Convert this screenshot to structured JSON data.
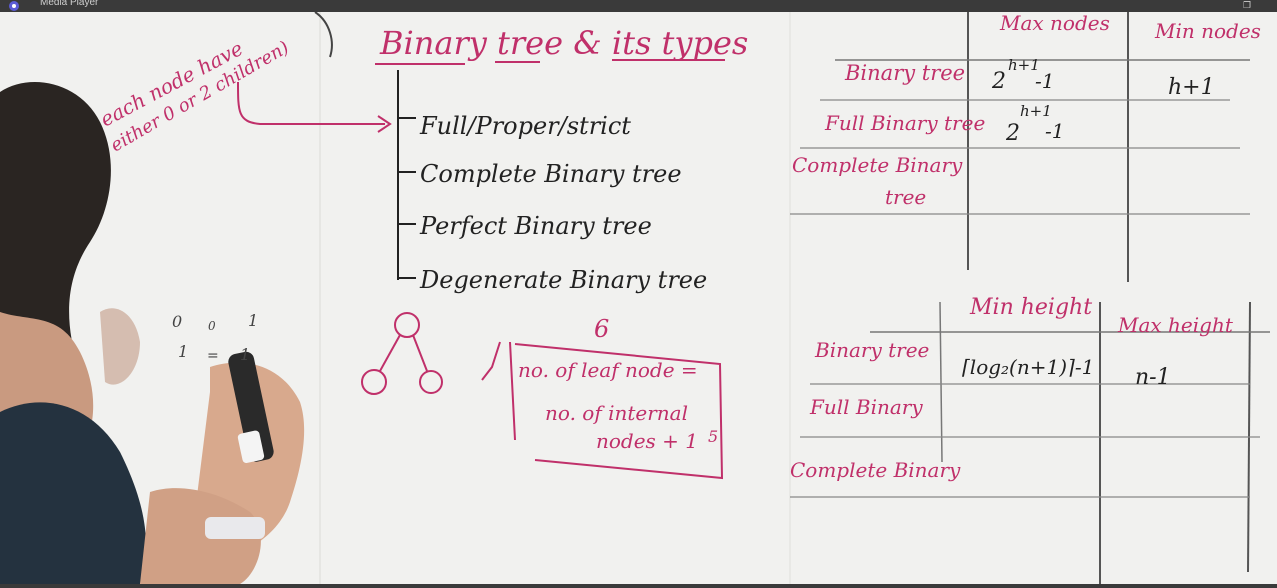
{
  "window": {
    "title": "Media Player"
  },
  "board": {
    "heading": "Binary tree & its types",
    "side_note_line1": "each node have",
    "side_note_line2": "either 0 or 2 children)",
    "types": [
      "Full/Proper/strict",
      "Complete Binary tree",
      "Perfect Binary tree",
      "Degenerate Binary tree"
    ],
    "nodes_table": {
      "headers": [
        "Max nodes",
        "Min nodes"
      ],
      "rows": [
        {
          "label": "Binary tree",
          "max_base": "2",
          "max_exp": "h+1",
          "max_tail": "-1",
          "min": "h+1"
        },
        {
          "label": "Full Binary tree",
          "max_base": "2",
          "max_exp": "h+1",
          "max_tail": "-1",
          "min": ""
        },
        {
          "label": "Complete Binary",
          "label2": "tree",
          "max_base": "",
          "max_exp": "",
          "max_tail": "",
          "min": ""
        }
      ]
    },
    "height_table": {
      "headers": [
        "Min height",
        "Max height"
      ],
      "rows": [
        {
          "label": "Binary tree",
          "min": "⌈log₂(n+1)⌉-1",
          "max": "n-1"
        },
        {
          "label": "Full Binary",
          "min": "",
          "max": ""
        },
        {
          "label": "Complete Binary",
          "min": "",
          "max": ""
        }
      ]
    },
    "box_number": "6",
    "box_line1": "no. of leaf node =",
    "box_line2": "no. of internal",
    "box_line3": "nodes + 1",
    "box_side": "5",
    "scribble_row1": [
      "0",
      "0",
      "1"
    ],
    "scribble_row2": [
      "1",
      "=",
      "1"
    ]
  },
  "colors": {
    "pink": "#c0306a",
    "black": "#222222",
    "board": "#f1f1ef"
  }
}
